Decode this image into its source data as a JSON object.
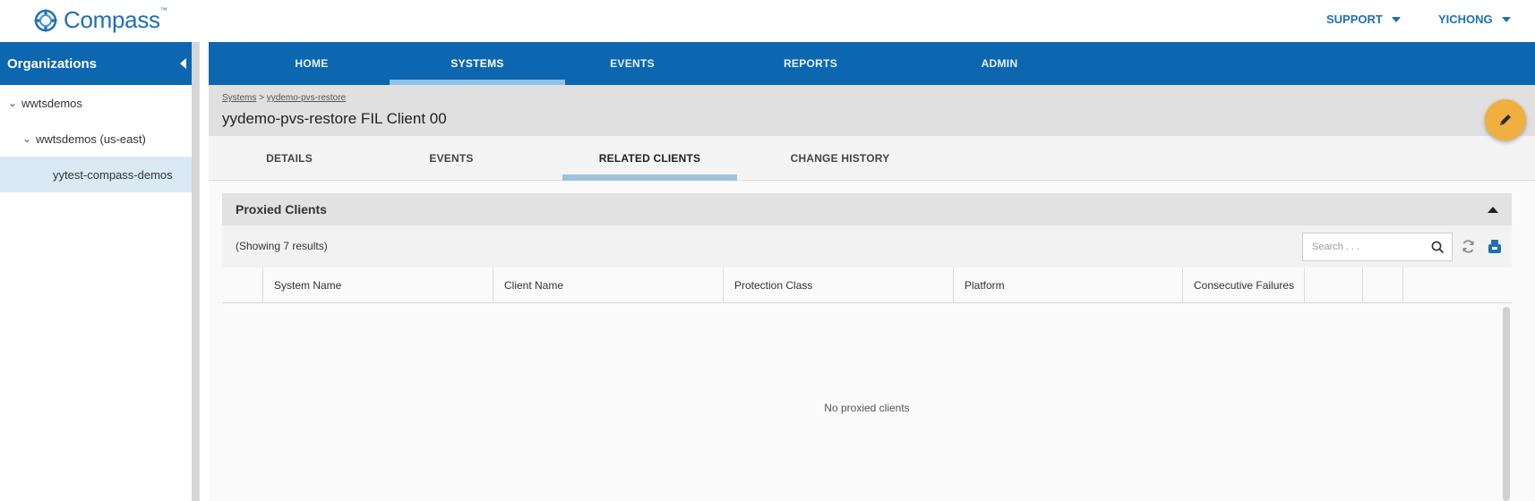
{
  "header": {
    "brand": "Compass",
    "trademark": "™",
    "support_label": "SUPPORT",
    "user_label": "YICHONG"
  },
  "sidebar": {
    "title": "Organizations",
    "items": [
      {
        "label": "wwtsdemos",
        "expanded": true
      },
      {
        "label": "wwtsdemos (us-east)",
        "expanded": true
      },
      {
        "label": "yytest-compass-demos",
        "selected": true
      }
    ]
  },
  "topnav": {
    "tabs": [
      "HOME",
      "SYSTEMS",
      "EVENTS",
      "REPORTS",
      "ADMIN"
    ],
    "active": "SYSTEMS"
  },
  "breadcrumb": {
    "root": "Systems",
    "separator": ">",
    "current": "yydemo-pvs-restore"
  },
  "page_title": "yydemo-pvs-restore FIL Client 00",
  "subtabs": {
    "tabs": [
      "DETAILS",
      "EVENTS",
      "RELATED CLIENTS",
      "CHANGE HISTORY"
    ],
    "active": "RELATED CLIENTS"
  },
  "panel": {
    "title": "Proxied Clients",
    "results_text": "(Showing 7 results)",
    "search_placeholder": "Search . . .",
    "columns": [
      "System Name",
      "Client Name",
      "Protection Class",
      "Platform",
      "Consecutive Failures"
    ],
    "empty_message": "No proxied clients"
  },
  "colors": {
    "primary": "#0d66b0",
    "brand": "#1f6fb5",
    "accent": "#f0b03f",
    "tab_indicator": "#8fc0e6"
  },
  "icons": {
    "logo": "compass-logo-icon",
    "edit": "pencil-icon",
    "search": "search-icon",
    "refresh": "refresh-icon",
    "export": "export-icon"
  }
}
